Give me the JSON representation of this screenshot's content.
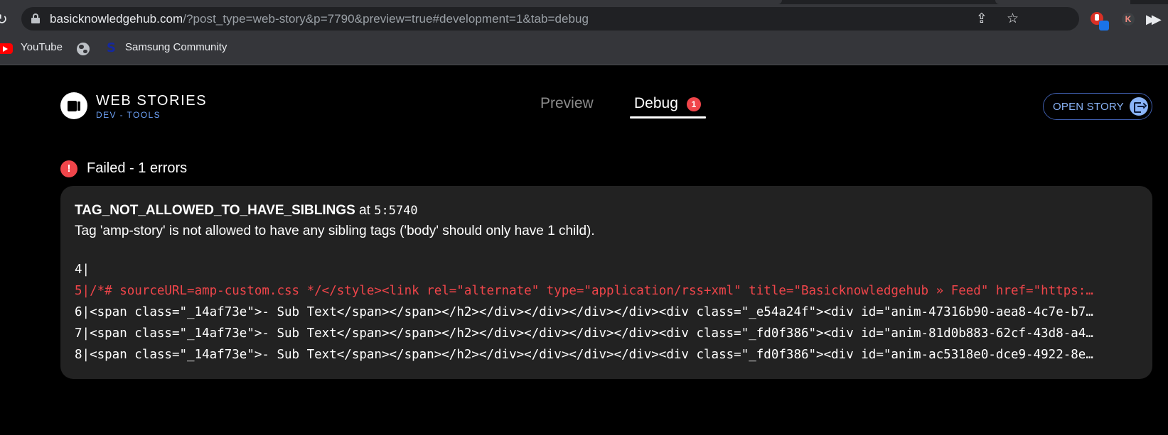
{
  "browser": {
    "url_host": "basicknowledgehub.com",
    "url_rest": "/?post_type=web-story&p=7790&preview=true#development=1&tab=debug",
    "bookmarks": [
      {
        "label": "YouTube",
        "icon": "youtube-icon"
      },
      {
        "label": "",
        "icon": "globe-icon"
      },
      {
        "label": "Samsung Community",
        "icon": "samsung-icon"
      }
    ],
    "extension_avatar": "K"
  },
  "header": {
    "brand_title": "WEB STORIES",
    "brand_subtitle": "DEV - TOOLS",
    "tabs": [
      {
        "label": "Preview",
        "active": false
      },
      {
        "label": "Debug",
        "active": true,
        "badge": "1"
      }
    ],
    "open_story_label": "OPEN STORY"
  },
  "status": {
    "icon": "!",
    "text": "Failed - 1 errors"
  },
  "error": {
    "code": "TAG_NOT_ALLOWED_TO_HAVE_SIBLINGS",
    "at_label": "at",
    "location": "5:5740",
    "message": "Tag 'amp-story' is not allowed to have any sibling tags ('body' should only have 1 child).",
    "snippet": [
      {
        "text": "4|",
        "highlight": false
      },
      {
        "text": "5|/*# sourceURL=amp-custom.css */</style><link rel=\"alternate\" type=\"application/rss+xml\" title=\"Basicknowledgehub » Feed\" href=\"https:…",
        "highlight": true
      },
      {
        "text": "6|<span class=\"_14af73e\">- Sub Text</span></span></h2></div></div></div></div><div class=\"_e54a24f\"><div id=\"anim-47316b90-aea8-4c7e-b7…",
        "highlight": false
      },
      {
        "text": "7|<span class=\"_14af73e\">- Sub Text</span></span></h2></div></div></div></div><div class=\"_fd0f386\"><div id=\"anim-81d0b883-62cf-43d8-a4…",
        "highlight": false
      },
      {
        "text": "8|<span class=\"_14af73e\">- Sub Text</span></span></h2></div></div></div></div><div class=\"_fd0f386\"><div id=\"anim-ac5318e0-dce9-4922-8e…",
        "highlight": false
      }
    ]
  },
  "colors": {
    "accent_blue": "#8ab4f8",
    "error_red": "#f0454a",
    "card_bg": "#222222"
  }
}
